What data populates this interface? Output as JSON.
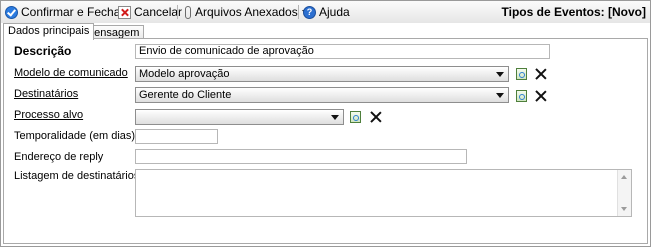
{
  "toolbar": {
    "confirm_label": "Confirmar e Fechar",
    "cancel_label": "Cancelar",
    "attachments_label": "Arquivos Anexados",
    "help_label": "Ajuda",
    "title": "Tipos de Eventos: [Novo]"
  },
  "tabs": [
    {
      "label": "Dados principais",
      "active": true
    },
    {
      "label": "Mensagem",
      "active": false
    }
  ],
  "form": {
    "descricao": {
      "label": "Descrição",
      "value": "Envio de comunicado de aprovação"
    },
    "modelo": {
      "label": "Modelo de comunicado",
      "value": "Modelo aprovação"
    },
    "destinatarios": {
      "label": "Destinatários",
      "value": "Gerente do Cliente"
    },
    "processo": {
      "label": "Processo alvo",
      "value": ""
    },
    "temporalidade": {
      "label": "Temporalidade (em dias)",
      "value": ""
    },
    "reply": {
      "label": "Endereço de reply",
      "value": ""
    },
    "listagem": {
      "label": "Listagem de destinatários",
      "value": ""
    }
  },
  "icons": {
    "confirm": "check-circle-icon",
    "cancel": "cancel-icon",
    "attachments": "paperclip-icon",
    "help": "help-icon",
    "new": "new-item-icon",
    "clear": "clear-x-icon"
  }
}
